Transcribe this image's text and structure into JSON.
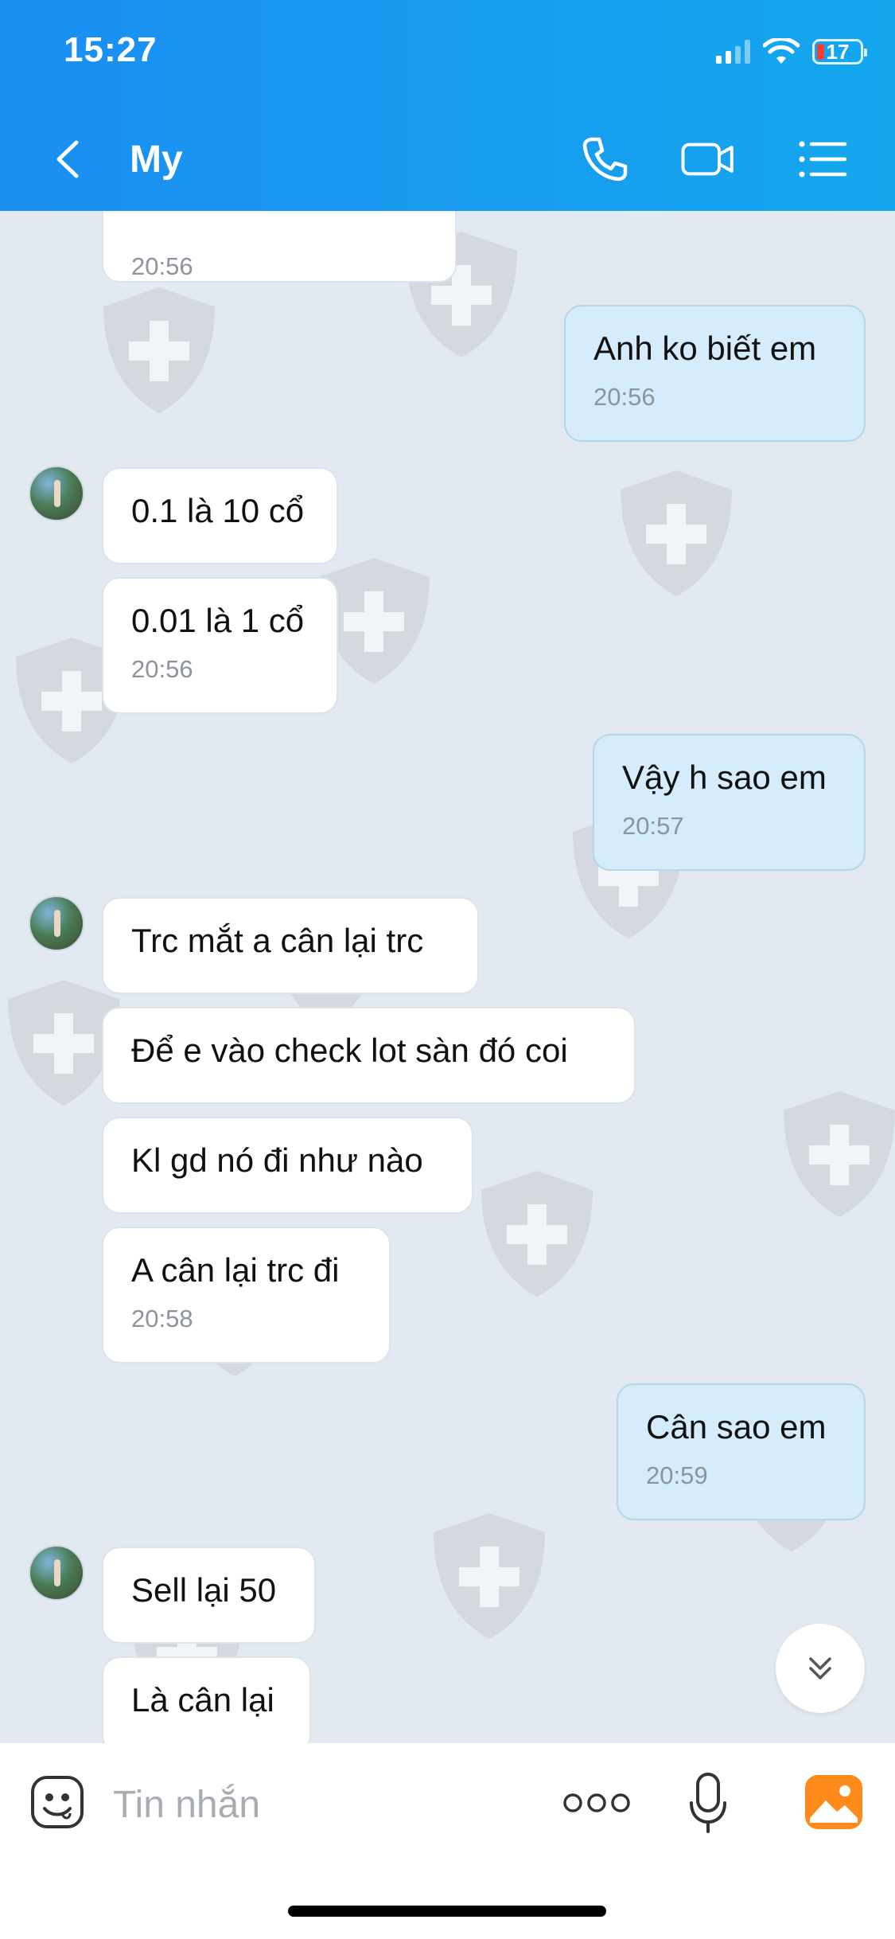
{
  "status_bar": {
    "time": "15:27",
    "battery": "17"
  },
  "header": {
    "contact_name": "My"
  },
  "messages": [
    {
      "side": "in",
      "text": "",
      "time": "20:56"
    },
    {
      "side": "out",
      "text": "Anh ko biết em",
      "time": "20:56"
    },
    {
      "side": "in",
      "text": "0.1 là 10 cổ",
      "time": ""
    },
    {
      "side": "in",
      "text": "0.01 là 1 cổ",
      "time": "20:56"
    },
    {
      "side": "out",
      "text": "Vậy h sao em",
      "time": "20:57"
    },
    {
      "side": "in",
      "text": "Trc mắt a cân lại trc",
      "time": ""
    },
    {
      "side": "in",
      "text": "Để e vào check lot sàn đó coi",
      "time": ""
    },
    {
      "side": "in",
      "text": "Kl gd nó đi như nào",
      "time": ""
    },
    {
      "side": "in",
      "text": "A cân lại trc đi",
      "time": "20:58"
    },
    {
      "side": "out",
      "text": "Cân sao em",
      "time": "20:59"
    },
    {
      "side": "in",
      "text": "Sell lại 50",
      "time": ""
    },
    {
      "side": "in",
      "text": "Là cân lại",
      "time": ""
    }
  ],
  "composer": {
    "placeholder": "Tin nhắn"
  },
  "icons": {
    "back": "chevron-left-icon",
    "call": "phone-icon",
    "video": "video-camera-icon",
    "menu": "list-menu-icon",
    "emoji": "sticker-icon",
    "more": "more-dots-icon",
    "mic": "microphone-icon",
    "photo": "photo-icon",
    "scroll": "double-chevron-down-icon"
  },
  "colors": {
    "header": "#1b8ef2",
    "outgoing_bubble": "#d4ecfb",
    "incoming_bubble": "#ffffff",
    "chat_background": "#e2e9f1",
    "photo_icon": "#ff8a1c"
  }
}
